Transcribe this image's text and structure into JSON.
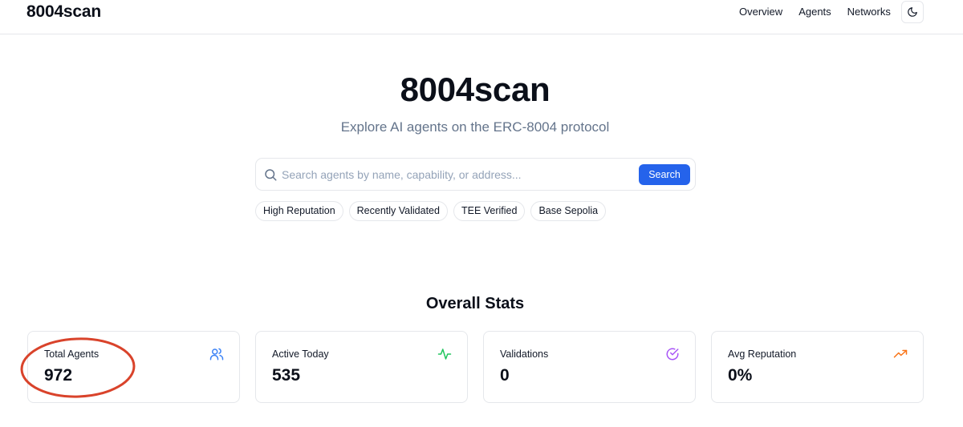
{
  "header": {
    "logo": "8004scan",
    "nav": [
      "Overview",
      "Agents",
      "Networks"
    ],
    "theme_icon": "moon-icon"
  },
  "hero": {
    "title": "8004scan",
    "subtitle": "Explore AI agents on the ERC-8004 protocol"
  },
  "search": {
    "placeholder": "Search agents by name, capability, or address...",
    "value": "",
    "button_label": "Search",
    "icon": "search-icon"
  },
  "chips": [
    "High Reputation",
    "Recently Validated",
    "TEE Verified",
    "Base Sepolia"
  ],
  "stats": {
    "title": "Overall Stats",
    "cards": [
      {
        "label": "Total Agents",
        "value": "972",
        "icon": "users-icon",
        "color": "#3b82f6"
      },
      {
        "label": "Active Today",
        "value": "535",
        "icon": "activity-icon",
        "color": "#22c55e"
      },
      {
        "label": "Validations",
        "value": "0",
        "icon": "check-circle-icon",
        "color": "#a855f7"
      },
      {
        "label": "Avg Reputation",
        "value": "0%",
        "icon": "trending-up-icon",
        "color": "#f97316"
      }
    ]
  },
  "annotation": {
    "type": "circle",
    "target": "Total Agents",
    "color": "#d9432b"
  },
  "colors": {
    "accent": "#2563eb",
    "border": "#e5e7eb",
    "muted_text": "#64748b"
  }
}
